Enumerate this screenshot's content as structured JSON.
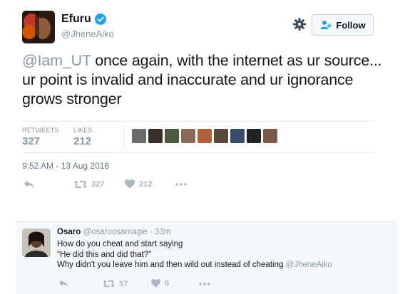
{
  "tweet": {
    "author_name": "Efuru",
    "verified": true,
    "author_handle": "@JheneAiko",
    "follow_label": "Follow",
    "text_mention": "@Iam_UT",
    "text_body": " once again, with the internet as ur source... ur point is invalid and inaccurate and ur ignorance grows stronger",
    "retweets_label": "RETWEETS",
    "retweets_count": "327",
    "likes_label": "LIKES",
    "likes_count": "212",
    "timestamp": "9:52 AM - 13 Aug 2016",
    "actions": {
      "reply_icon": "reply-icon",
      "retweet_icon": "retweet-icon",
      "retweet_count": "327",
      "like_icon": "heart-icon",
      "like_count": "212",
      "more_icon": "more-icon"
    },
    "liker_colors": [
      "#6b6b6b",
      "#3a2e2a",
      "#4a5a3a",
      "#8a6a5a",
      "#b0603a",
      "#5a4a3a",
      "#3a4a6a",
      "#222222",
      "#7a5a4a"
    ]
  },
  "reply": {
    "author_name": "Osaro",
    "author_handle": "@osaroosamagie",
    "separator": " · ",
    "time": "33m",
    "line1": "How do you cheat and start saying",
    "line2": "\"He did this and did that?\"",
    "line3_text": "Why didn't you leave him and then wild out instead of cheating ",
    "line3_mention": "@JheneAiko",
    "actions": {
      "retweet_count": "57",
      "like_count": "6"
    }
  },
  "colors": {
    "text": "#14171a",
    "muted": "#8899a6",
    "verified_blue": "#1da1f2",
    "action_grey": "#aab8c2",
    "reply_bg": "#f5f8fa"
  }
}
